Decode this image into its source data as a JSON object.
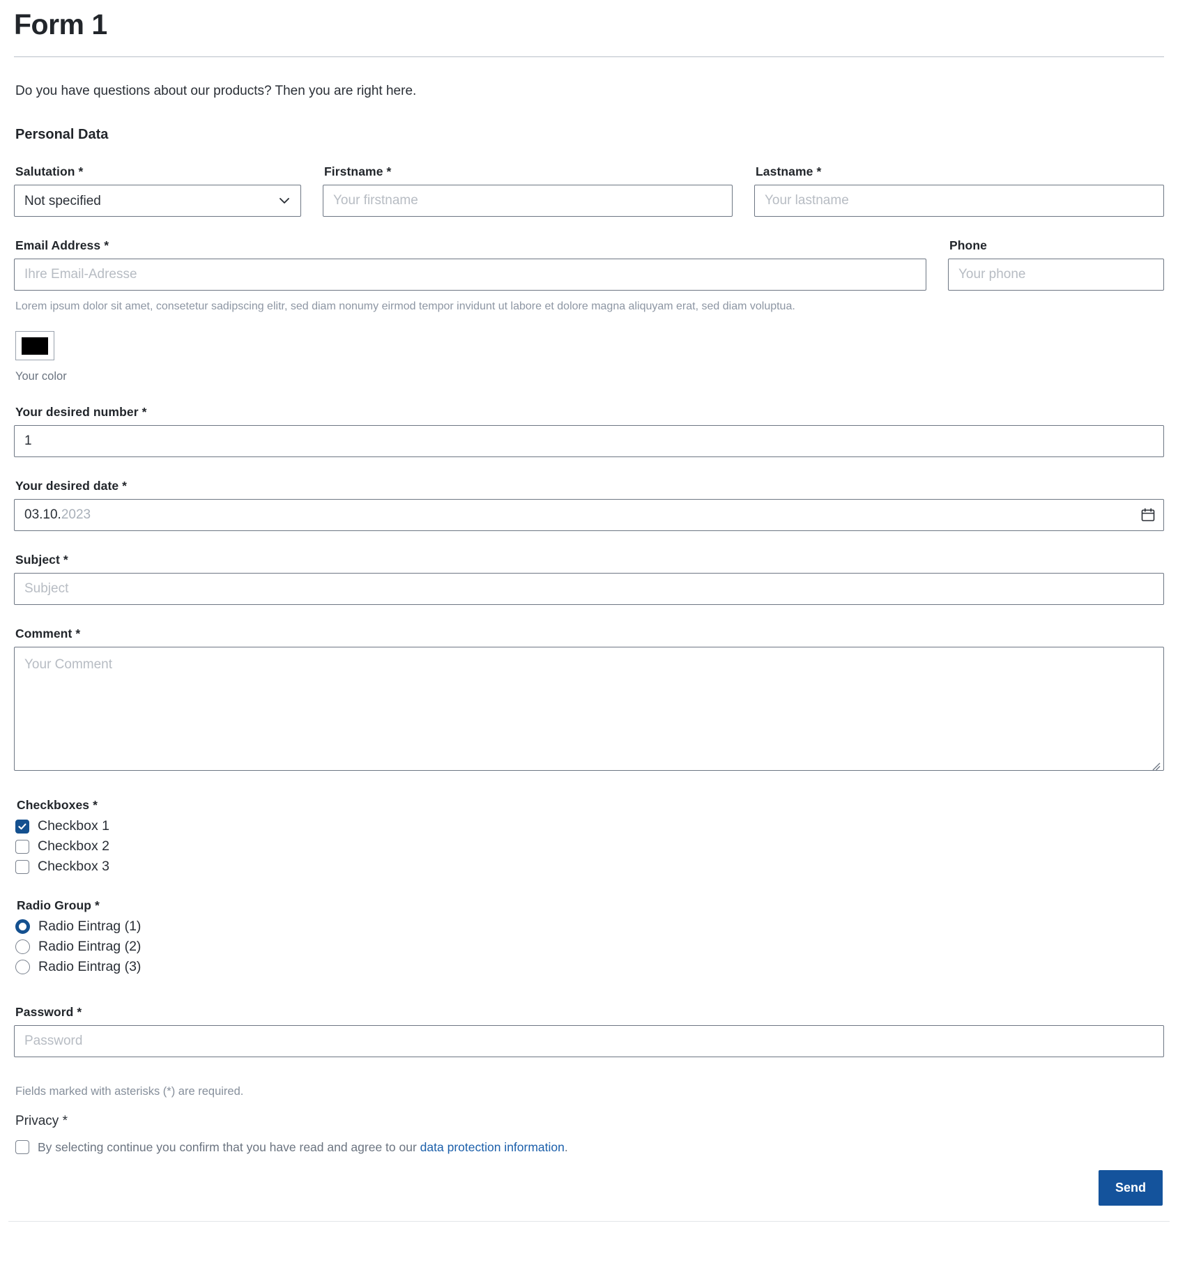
{
  "page": {
    "title": "Form 1",
    "intro": "Do you have questions about our products? Then you are right here.",
    "section_heading": "Personal Data"
  },
  "fields": {
    "salutation": {
      "label": "Salutation *",
      "selected": "Not specified",
      "options": [
        "Not specified"
      ],
      "icon": "chevron-down-icon"
    },
    "firstname": {
      "label": "Firstname *",
      "placeholder": "Your firstname",
      "value": ""
    },
    "lastname": {
      "label": "Lastname *",
      "placeholder": "Your lastname",
      "value": ""
    },
    "email": {
      "label": "Email Address *",
      "placeholder": "Ihre Email-Adresse",
      "value": "",
      "helper": "Lorem ipsum dolor sit amet, consetetur sadipscing elitr, sed diam nonumy eirmod tempor invidunt ut labore et dolore magna aliquyam erat, sed diam voluptua."
    },
    "phone": {
      "label": "Phone",
      "placeholder": "Your phone",
      "value": ""
    },
    "color": {
      "caption": "Your color",
      "value": "#000000"
    },
    "number": {
      "label": "Your desired number *",
      "value": "1"
    },
    "date": {
      "label": "Your desired date *",
      "value_day_month": "03.10.",
      "value_year": "2023",
      "icon": "calendar-icon"
    },
    "subject": {
      "label": "Subject *",
      "placeholder": "Subject",
      "value": ""
    },
    "comment": {
      "label": "Comment *",
      "placeholder": "Your Comment",
      "value": ""
    },
    "checkboxes": {
      "label": "Checkboxes *",
      "items": [
        {
          "label": "Checkbox 1",
          "checked": true
        },
        {
          "label": "Checkbox 2",
          "checked": false
        },
        {
          "label": "Checkbox 3",
          "checked": false
        }
      ]
    },
    "radios": {
      "label": "Radio Group *",
      "items": [
        {
          "label": "Radio Eintrag (1)",
          "selected": true
        },
        {
          "label": "Radio Eintrag (2)",
          "selected": false
        },
        {
          "label": "Radio Eintrag (3)",
          "selected": false
        }
      ]
    },
    "password": {
      "label": "Password *",
      "placeholder": "Password",
      "value": ""
    }
  },
  "footer": {
    "required_note": "Fields marked with asterisks (*) are required.",
    "privacy_label": "Privacy *",
    "privacy_text": "By selecting continue you confirm that you have read and agree to our ",
    "privacy_link": "data protection information",
    "privacy_period": ".",
    "privacy_checked": false,
    "send_label": "Send"
  },
  "colors": {
    "accent": "#14539c",
    "checkbox_on": "#14508f",
    "link": "#1b5faa",
    "border": "#6d7683",
    "muted_text": "#868f9b"
  }
}
